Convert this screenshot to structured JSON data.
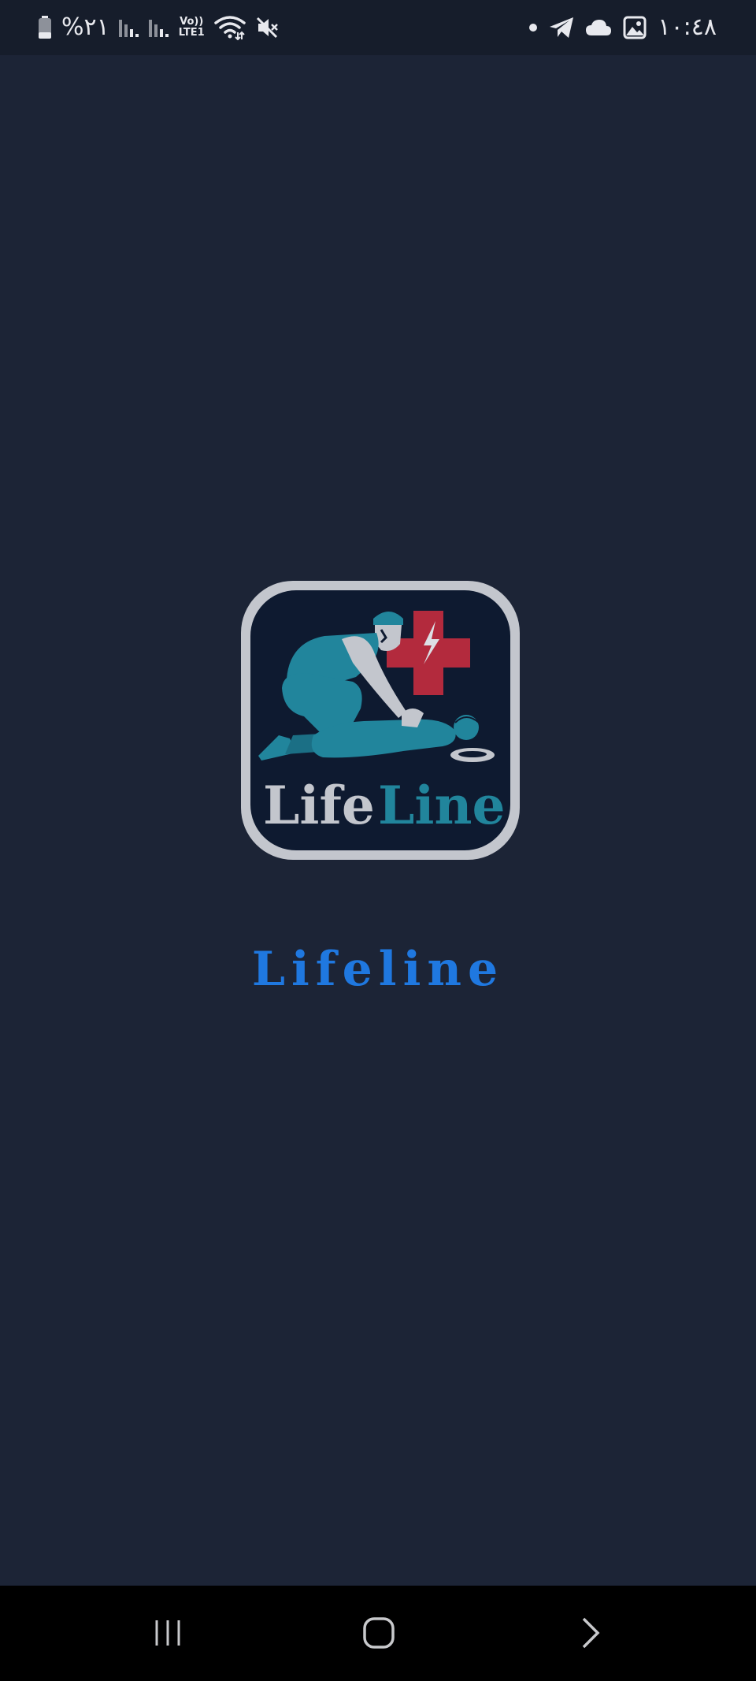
{
  "status_bar": {
    "battery_text": "%۲۱",
    "network_label_top": "Vo))",
    "network_label_bottom": "LTE1",
    "clock_text": "۱۰:٤٨",
    "icons": [
      "battery-icon",
      "signal-icon",
      "signal-icon",
      "wifi-icon",
      "mute-icon",
      "dot-icon",
      "telegram-icon",
      "cloud-icon",
      "gallery-icon"
    ]
  },
  "splash": {
    "logo_text_left": "Life",
    "logo_text_right": "Line",
    "app_name": "Lifeline"
  },
  "colors": {
    "background": "#1c2436",
    "status_bar": "#161d2b",
    "logo_frame": "#c3c6cd",
    "logo_inner": "#0e1a30",
    "logo_teal": "#21859c",
    "logo_cross": "#b32a3d",
    "app_name": "#1f78e0",
    "nav_bar": "#000000"
  },
  "nav_bar": {
    "buttons": [
      "recents-icon",
      "home-icon",
      "back-icon"
    ]
  }
}
